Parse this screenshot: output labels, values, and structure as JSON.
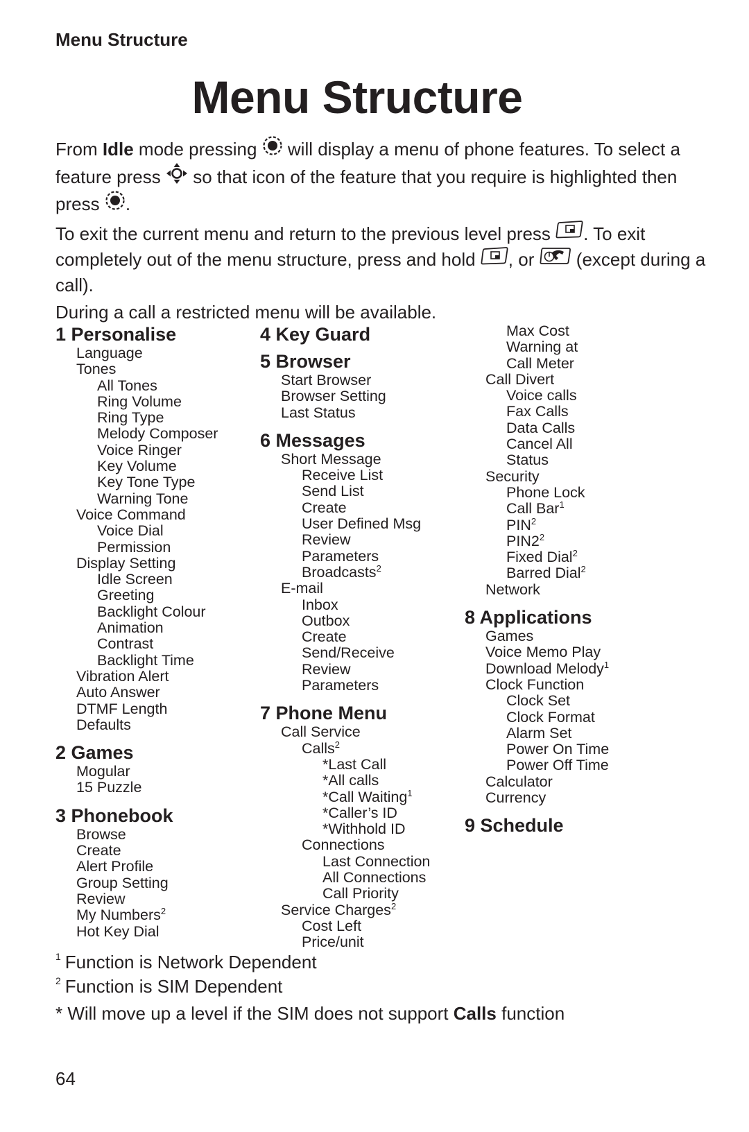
{
  "header": {
    "running_head": "Menu Structure",
    "title": "Menu Structure"
  },
  "intro": {
    "p1_a": "From ",
    "p1_idle": "Idle",
    "p1_b": " mode pressing ",
    "p1_c": " will display a menu of phone features. To select a feature press ",
    "p1_d": " so that icon of the feature that you require is highlighted then press ",
    "p1_e": ".",
    "p2_a": "To exit the current menu and return to the previous level press ",
    "p2_b": ". To exit completely out of the menu structure, press and hold ",
    "p2_c": ", or ",
    "p2_d": " (except during a call).",
    "p3": "During a call a restricted menu will be available.",
    "icons": {
      "select": "select-key-icon",
      "navigate": "navigation-key-icon",
      "back": "back-softkey-icon",
      "end": "end-call-key-icon"
    }
  },
  "columns": [
    [
      {
        "heading": "1 Personalise",
        "items": [
          {
            "t": "Language",
            "l": 1
          },
          {
            "t": "Tones",
            "l": 1
          },
          {
            "t": "All Tones",
            "l": 2
          },
          {
            "t": "Ring Volume",
            "l": 2
          },
          {
            "t": "Ring Type",
            "l": 2
          },
          {
            "t": "Melody Composer",
            "l": 2
          },
          {
            "t": "Voice Ringer",
            "l": 2
          },
          {
            "t": "Key Volume",
            "l": 2
          },
          {
            "t": "Key Tone Type",
            "l": 2
          },
          {
            "t": "Warning Tone",
            "l": 2
          },
          {
            "t": "Voice Command",
            "l": 1
          },
          {
            "t": "Voice Dial",
            "l": 2
          },
          {
            "t": "Permission",
            "l": 2
          },
          {
            "t": "Display Setting",
            "l": 1
          },
          {
            "t": "Idle Screen",
            "l": 2
          },
          {
            "t": "Greeting",
            "l": 2
          },
          {
            "t": "Backlight Colour",
            "l": 2
          },
          {
            "t": "Animation",
            "l": 2
          },
          {
            "t": "Contrast",
            "l": 2
          },
          {
            "t": "Backlight Time",
            "l": 2
          },
          {
            "t": "Vibration Alert",
            "l": 1
          },
          {
            "t": "Auto Answer",
            "l": 1
          },
          {
            "t": "DTMF Length",
            "l": 1
          },
          {
            "t": "Defaults",
            "l": 1
          }
        ]
      },
      {
        "heading": "2 Games",
        "items": [
          {
            "t": "Mogular",
            "l": 1
          },
          {
            "t": "15 Puzzle",
            "l": 1
          }
        ]
      },
      {
        "heading": "3 Phonebook",
        "items": [
          {
            "t": "Browse",
            "l": 1
          },
          {
            "t": "Create",
            "l": 1
          },
          {
            "t": "Alert Profile",
            "l": 1
          },
          {
            "t": "Group Setting",
            "l": 1
          },
          {
            "t": "Review",
            "l": 1
          },
          {
            "t": "My Numbers",
            "l": 1,
            "sup": "2"
          },
          {
            "t": "Hot Key Dial",
            "l": 1
          }
        ]
      }
    ],
    [
      {
        "heading": "4 Key Guard",
        "items": []
      },
      {
        "heading": "5 Browser",
        "items": [
          {
            "t": "Start Browser",
            "l": 1
          },
          {
            "t": "Browser Setting",
            "l": 1
          },
          {
            "t": "Last Status",
            "l": 1
          }
        ]
      },
      {
        "heading": "6 Messages",
        "items": [
          {
            "t": "Short Message",
            "l": 1
          },
          {
            "t": "Receive List",
            "l": 2
          },
          {
            "t": "Send List",
            "l": 2
          },
          {
            "t": "Create",
            "l": 2
          },
          {
            "t": "User Defined Msg",
            "l": 2
          },
          {
            "t": "Review",
            "l": 2
          },
          {
            "t": "Parameters",
            "l": 2
          },
          {
            "t": "Broadcasts",
            "l": 2,
            "sup": "2"
          },
          {
            "t": "E-mail",
            "l": 1
          },
          {
            "t": "Inbox",
            "l": 2
          },
          {
            "t": "Outbox",
            "l": 2
          },
          {
            "t": "Create",
            "l": 2
          },
          {
            "t": "Send/Receive",
            "l": 2
          },
          {
            "t": "Review",
            "l": 2
          },
          {
            "t": "Parameters",
            "l": 2
          }
        ]
      },
      {
        "heading": "7  Phone Menu",
        "items": [
          {
            "t": "Call Service",
            "l": 1
          },
          {
            "t": "Calls",
            "l": 2,
            "sup": "2"
          },
          {
            "t": "*Last Call",
            "l": 3
          },
          {
            "t": "*All calls",
            "l": 3
          },
          {
            "t": "*Call Waiting",
            "l": 3,
            "sup": "1"
          },
          {
            "t": "*Caller’s ID",
            "l": 3
          },
          {
            "t": "*Withhold ID",
            "l": 3
          },
          {
            "t": "Connections",
            "l": 2
          },
          {
            "t": "Last Connection",
            "l": 3
          },
          {
            "t": "All Connections",
            "l": 3
          },
          {
            "t": "Call Priority",
            "l": 3
          },
          {
            "t": "Service Charges",
            "l": 1,
            "sup": "2"
          },
          {
            "t": "Cost Left",
            "l": 2
          },
          {
            "t": "Price/unit",
            "l": 2
          }
        ]
      }
    ],
    [
      {
        "heading": "",
        "items": [
          {
            "t": "Max Cost",
            "l": 2
          },
          {
            "t": "Warning at",
            "l": 2
          },
          {
            "t": "Call Meter",
            "l": 2
          },
          {
            "t": "Call Divert",
            "l": 1
          },
          {
            "t": "Voice calls",
            "l": 2
          },
          {
            "t": "Fax Calls",
            "l": 2
          },
          {
            "t": "Data Calls",
            "l": 2
          },
          {
            "t": "Cancel All",
            "l": 2
          },
          {
            "t": "Status",
            "l": 2
          },
          {
            "t": "Security",
            "l": 1
          },
          {
            "t": "Phone Lock",
            "l": 2
          },
          {
            "t": "Call Bar",
            "l": 2,
            "sup": "1"
          },
          {
            "t": "PIN",
            "l": 2,
            "sup": "2"
          },
          {
            "t": "PIN2",
            "l": 2,
            "sup": "2"
          },
          {
            "t": "Fixed Dial",
            "l": 2,
            "sup": "2"
          },
          {
            "t": "Barred Dial",
            "l": 2,
            "sup": "2"
          },
          {
            "t": "Network",
            "l": 1
          }
        ]
      },
      {
        "heading": "8 Applications",
        "items": [
          {
            "t": "Games",
            "l": 1
          },
          {
            "t": "Voice Memo Play",
            "l": 1
          },
          {
            "t": "Download Melody",
            "l": 1,
            "sup": "1"
          },
          {
            "t": "Clock Function",
            "l": 1
          },
          {
            "t": "Clock Set",
            "l": 2
          },
          {
            "t": "Clock Format",
            "l": 2
          },
          {
            "t": "Alarm Set",
            "l": 2
          },
          {
            "t": "Power On Time",
            "l": 2
          },
          {
            "t": "Power Off Time",
            "l": 2
          },
          {
            "t": "Calculator",
            "l": 1
          },
          {
            "t": "Currency",
            "l": 1
          }
        ]
      },
      {
        "heading": "9 Schedule",
        "items": []
      }
    ]
  ],
  "footnotes": {
    "fn1_mark": "1",
    "fn1": "Function is Network Dependent",
    "fn2_mark": "2",
    "fn2": "Function is SIM Dependent",
    "star_a": "* Will move up a level if the SIM does not support ",
    "star_bold": "Calls",
    "star_b": " function"
  },
  "page_number": "64"
}
